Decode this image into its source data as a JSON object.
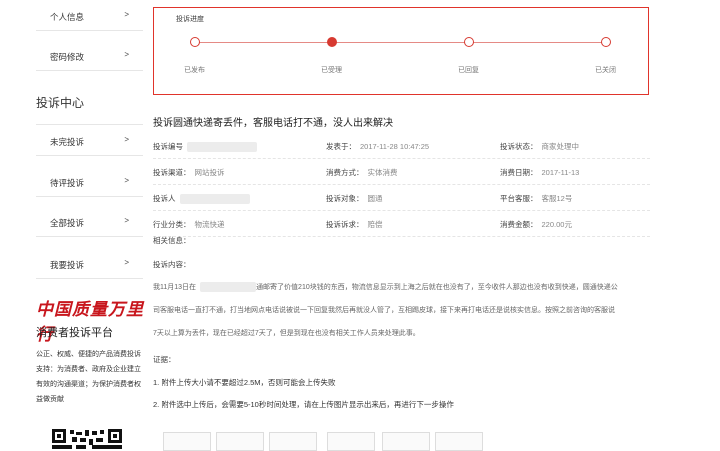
{
  "sidebar": {
    "items_top": [
      {
        "label": "个人信息"
      },
      {
        "label": "密码修改"
      }
    ],
    "center_title": "投诉中心",
    "items": [
      {
        "label": "未完投诉"
      },
      {
        "label": "待评投诉"
      },
      {
        "label": "全部投诉"
      },
      {
        "label": "我要投诉"
      }
    ],
    "chevron": ">",
    "logo_text": "中国质量万里行",
    "platform": "消费者投诉平台",
    "description": "公正、权威、便捷的产品消费投诉支持：为消费者、政府及企业建立有效的沟通渠道；为保护消费者权益做贡献"
  },
  "progress": {
    "title": "投诉进度",
    "steps": [
      {
        "label": "已发布",
        "active": false
      },
      {
        "label": "已受理",
        "active": true
      },
      {
        "label": "已回复",
        "active": false
      },
      {
        "label": "已关闭",
        "active": false
      }
    ]
  },
  "complaint": {
    "title": "投诉圆通快递寄丢件，客服电话打不通，没人出来解决",
    "fields": {
      "id_label": "投诉编号",
      "published_label": "发表于：",
      "published_value": "2017-11-28 10:47:25",
      "status_label": "投诉状态：",
      "status_value": "商家处理中",
      "channel_label": "投诉渠道：",
      "channel_value": "网站投诉",
      "consume_method_label": "消费方式：",
      "consume_method_value": "实体消费",
      "consume_date_label": "消费日期：",
      "consume_date_value": "2017-11-13",
      "complainant_label": "投诉人",
      "target_label": "投诉对象：",
      "target_value": "圆通",
      "platform_service_label": "平台客服：",
      "platform_service_value": "客服12号",
      "industry_label": "行业分类：",
      "industry_value": "物流快递",
      "demand_label": "投诉诉求：",
      "demand_value": "赔偿",
      "amount_label": "消费金额：",
      "amount_value": "220.00元"
    },
    "related_label": "相关信息：",
    "content_label": "投诉内容：",
    "content_lines": [
      "我11月13日在",
      "通邮寄了价值210块钱的东西，物流信息显示到上海之后就在也没有了，至今收件人那边也没有收到快递，圆通快递公",
      "司客服电话一直打不通，打当地网点电话说被说一下回复我然后再就没人管了，互相踢皮球，接下来再打电话还是说核实信息。按照之前咨询的客服说",
      "7天以上算为丢件，现在已经超过7天了，但是到现在也没有相关工作人员来处理此事。"
    ],
    "evidence_label": "证据：",
    "notes": [
      "1. 附件上传大小请不要超过2.5M，否则可能会上传失败",
      "2. 附件选中上传后，会需要5-10秒时间处理，请在上传图片显示出来后，再进行下一步操作"
    ]
  },
  "colors": {
    "accent": "#d73a31",
    "border": "#e0342b"
  }
}
